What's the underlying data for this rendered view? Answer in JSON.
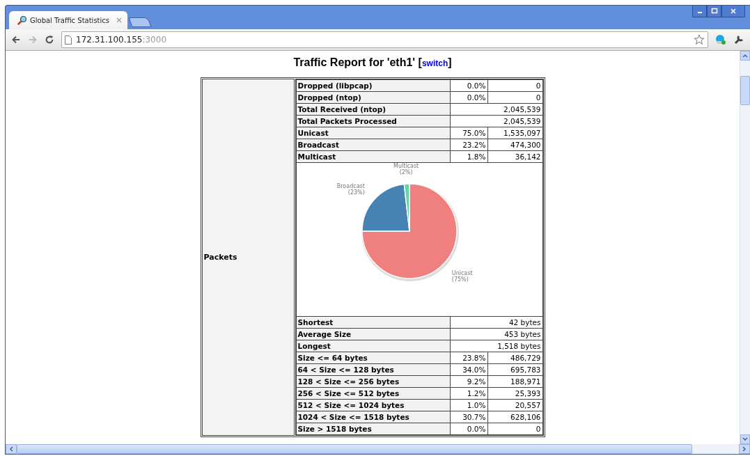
{
  "browser": {
    "tabs": [
      {
        "title": "Global Traffic Statistics",
        "selected": true
      }
    ],
    "forward_disabled": true,
    "address": {
      "host": "172.31.100.155",
      "port": ":3000"
    }
  },
  "page": {
    "heading_before": "Traffic Report for 'eth1' [",
    "link": "switch",
    "heading_after": "]"
  },
  "section": {
    "label": "Packets",
    "rows": [
      {
        "kind": "split",
        "label": "Dropped (libpcap)",
        "pct": "0.0%",
        "value": "0"
      },
      {
        "kind": "split",
        "label": "Dropped (ntop)",
        "pct": "0.0%",
        "value": "0"
      },
      {
        "kind": "span",
        "label": "Total Received (ntop)",
        "value": "2,045,539"
      },
      {
        "kind": "span",
        "label": "Total Packets Processed",
        "value": "2,045,539"
      },
      {
        "kind": "split",
        "label": "Unicast",
        "pct": "75.0%",
        "value": "1,535,097"
      },
      {
        "kind": "split",
        "label": "Broadcast",
        "pct": "23.2%",
        "value": "474,300"
      },
      {
        "kind": "split",
        "label": "Multicast",
        "pct": "1.8%",
        "value": "36,142"
      },
      {
        "kind": "chart",
        "chart_data": {
          "type": "pie",
          "categories": [
            "Unicast",
            "Broadcast",
            "Multicast"
          ],
          "values": [
            75.0,
            23.2,
            1.8
          ],
          "colors": [
            "#f08080",
            "#4682b4",
            "#66d4a8"
          ],
          "value_labels": [
            "(75%)",
            "(23%)",
            "(2%)"
          ]
        }
      },
      {
        "kind": "span",
        "label": "Shortest",
        "value": "42 bytes"
      },
      {
        "kind": "span",
        "label": "Average Size",
        "value": "453 bytes"
      },
      {
        "kind": "span",
        "label": "Longest",
        "value": "1,518 bytes"
      },
      {
        "kind": "split",
        "label": "Size <= 64 bytes",
        "pct": "23.8%",
        "value": "486,729"
      },
      {
        "kind": "split",
        "label": "64 < Size <= 128 bytes",
        "pct": "34.0%",
        "value": "695,783"
      },
      {
        "kind": "split",
        "label": "128 < Size <= 256 bytes",
        "pct": "9.2%",
        "value": "188,971"
      },
      {
        "kind": "split",
        "label": "256 < Size <= 512 bytes",
        "pct": "1.2%",
        "value": "25,393"
      },
      {
        "kind": "split",
        "label": "512 < Size <= 1024 bytes",
        "pct": "1.0%",
        "value": "20,557"
      },
      {
        "kind": "split",
        "label": "1024 < Size <= 1518 bytes",
        "pct": "30.7%",
        "value": "628,106"
      },
      {
        "kind": "split",
        "label": "Size > 1518 bytes",
        "pct": "0.0%",
        "value": "0"
      }
    ]
  }
}
